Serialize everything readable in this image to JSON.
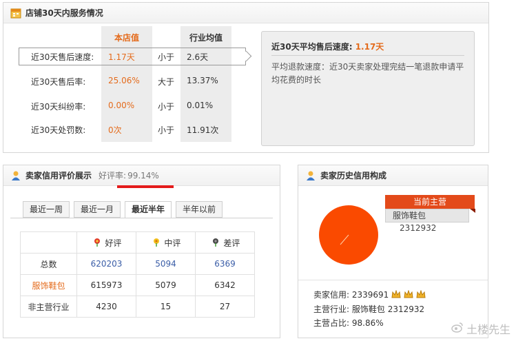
{
  "store_service": {
    "title": "店铺30天内服务情况",
    "col_store": "本店值",
    "col_industry": "行业均值",
    "rows": [
      {
        "label": "近30天售后速度:",
        "store": "1.17天",
        "compare": "小于",
        "industry": "2.6天"
      },
      {
        "label": "近30天售后率:",
        "store": "25.06%",
        "compare": "大于",
        "industry": "13.37%"
      },
      {
        "label": "近30天纠纷率:",
        "store": "0.00%",
        "compare": "小于",
        "industry": "0.01%"
      },
      {
        "label": "近30天处罚数:",
        "store": "0次",
        "compare": "小于",
        "industry": "11.91次"
      }
    ],
    "tip": {
      "title_prefix": "近30天平均售后速度:",
      "title_value": "1.17天",
      "text": "平均退款速度：近30天卖家处理完结一笔退款申请平均花费的时长"
    }
  },
  "credit": {
    "title": "卖家信用评价展示",
    "good_rate_label": "好评率:",
    "good_rate_value": "99.14%",
    "tabs": [
      "最近一周",
      "最近一月",
      "最近半年",
      "半年以前"
    ],
    "active_tab": "最近半年",
    "headers": [
      "好评",
      "中评",
      "差评"
    ],
    "rows": [
      {
        "label": "总数",
        "values": [
          "620203",
          "5094",
          "6369"
        ]
      },
      {
        "label": "服饰鞋包",
        "values": [
          "615973",
          "5079",
          "6342"
        ]
      },
      {
        "label": "非主营行业",
        "values": [
          "4230",
          "15",
          "27"
        ]
      }
    ]
  },
  "history": {
    "title": "卖家历史信用构成",
    "tag_title": "当前主营",
    "tag_category": "服饰鞋包",
    "tag_value": "2312932",
    "chart_data": {
      "type": "pie",
      "categories": [
        "服饰鞋包"
      ],
      "values": [
        2312932
      ],
      "colors": [
        "#fa4a00"
      ]
    },
    "credit_label": "卖家信用:",
    "credit_value": "2339691",
    "main_label": "主营行业:",
    "main_value": "服饰鞋包 2312932",
    "ratio_label": "主营占比:",
    "ratio_value": "98.86%"
  },
  "watermark": "土楼先生"
}
